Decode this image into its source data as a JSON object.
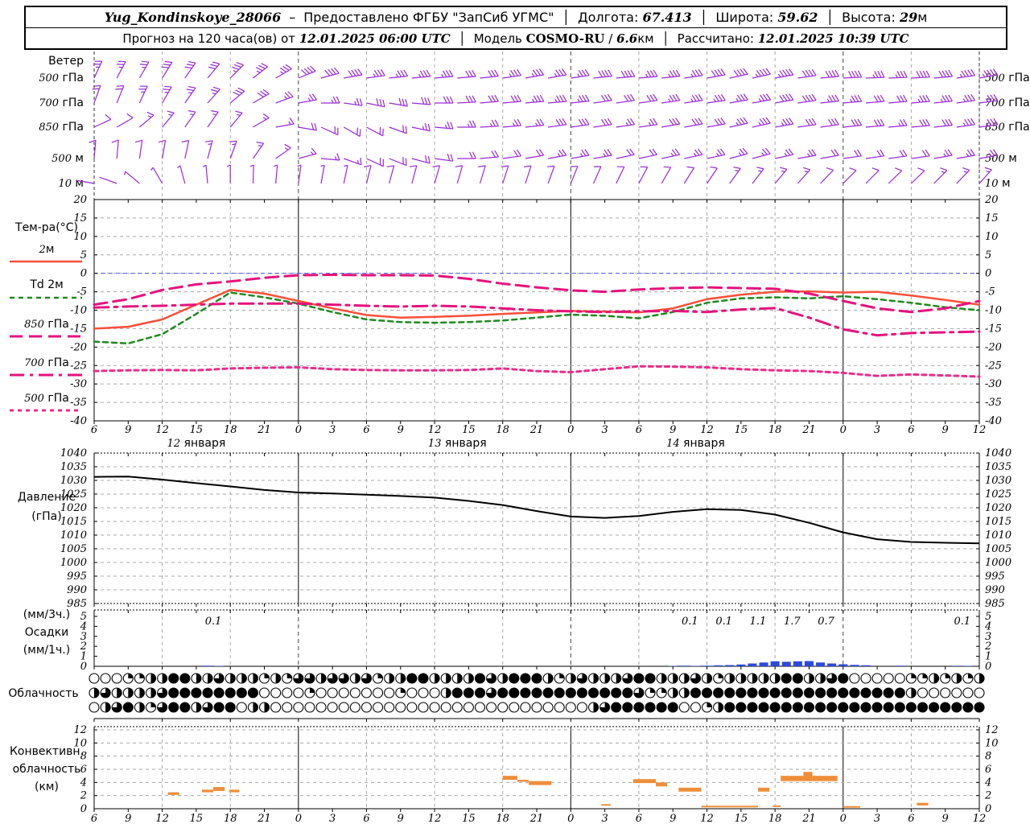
{
  "header": {
    "station": "Yug_Kondinskoye_28066",
    "dash": "–",
    "provided": "Предоставлено ФГБУ \"ЗапСиб УГМС\"",
    "lon_label": "Долгота:",
    "lon": "67.413",
    "lat_label": "Широта:",
    "lat": "59.62",
    "alt_label": "Высота:",
    "alt": "29",
    "alt_unit": "м",
    "sep": "│",
    "forecast_label": "Прогноз на 120 часа(ов) от",
    "forecast_start": "12.01.2025 06:00 UTC",
    "model_label": "Модель",
    "model": "COSMO-RU",
    "model_res_slash": "/",
    "model_res": "6.6",
    "model_res_unit": "км",
    "calc_label": "Рассчитано:",
    "calc_time": "12.01.2025 10:39 UTC"
  },
  "colors": {
    "wind": "#9a28d8",
    "temp_2m": "#f94f38",
    "td_2m": "#1f8a1f",
    "t850": "#e6127d",
    "t700": "#e6127d",
    "t500": "#ee2a8a",
    "pressure": "#000000",
    "precip": "#2b49dd",
    "convective": "#ef8e38",
    "zero_line": "#4a58f0",
    "grid": "#a8a8a8"
  },
  "time_axis": {
    "t_start_h": 0,
    "t_end_h": 78,
    "tick_step_h": 3,
    "labels": [
      "6",
      "9",
      "12",
      "15",
      "18",
      "21",
      "0",
      "3",
      "6",
      "9",
      "12",
      "15",
      "18",
      "21",
      "0",
      "3",
      "6",
      "9",
      "12",
      "15",
      "18",
      "21",
      "0",
      "3",
      "6",
      "9",
      "12"
    ],
    "midnights_t": [
      18,
      42,
      66
    ],
    "dates": [
      {
        "label": "12 января",
        "t": 9
      },
      {
        "label": "13 января",
        "t": 32
      },
      {
        "label": "14 января",
        "t": 53
      }
    ]
  },
  "wind_panel": {
    "title": "Ветер",
    "levels": [
      {
        "label": "500 гПа",
        "angles": [
          65,
          62,
          60,
          58,
          55,
          50,
          45,
          38,
          30,
          22,
          15,
          10,
          8,
          6,
          5,
          5,
          5,
          6,
          8,
          10,
          10,
          8,
          6,
          5,
          5,
          6,
          8,
          10,
          12,
          12,
          10,
          8,
          5,
          3,
          2,
          2,
          3,
          5,
          8,
          10
        ],
        "knots": [
          25,
          25,
          25,
          30,
          30,
          30,
          35,
          35,
          35,
          40,
          40,
          40,
          35,
          35,
          35,
          35,
          30,
          30,
          35,
          35,
          35,
          35,
          40,
          40,
          35,
          35,
          35,
          40,
          40,
          45,
          45,
          40,
          40,
          40,
          35,
          35,
          40,
          40,
          45,
          45
        ]
      },
      {
        "label": "700 гПа",
        "angles": [
          70,
          68,
          65,
          60,
          55,
          48,
          40,
          30,
          20,
          10,
          0,
          -8,
          -12,
          -10,
          -5,
          0,
          3,
          5,
          5,
          5,
          5,
          6,
          8,
          8,
          8,
          8,
          8,
          8,
          10,
          10,
          10,
          8,
          6,
          5,
          5,
          5,
          5,
          6,
          8,
          8
        ],
        "knots": [
          20,
          20,
          25,
          25,
          25,
          25,
          30,
          30,
          25,
          25,
          25,
          25,
          30,
          30,
          30,
          30,
          30,
          30,
          30,
          35,
          35,
          35,
          30,
          30,
          30,
          35,
          35,
          35,
          35,
          35,
          40,
          40,
          35,
          35,
          30,
          30,
          35,
          35,
          35,
          35
        ]
      },
      {
        "label": "850 гПа",
        "angles": [
          25,
          30,
          40,
          50,
          55,
          55,
          50,
          30,
          10,
          -10,
          -25,
          -30,
          -28,
          -20,
          -12,
          -5,
          0,
          3,
          5,
          6,
          8,
          8,
          8,
          8,
          8,
          10,
          10,
          10,
          12,
          12,
          10,
          8,
          8,
          6,
          5,
          5,
          5,
          6,
          8,
          8
        ],
        "knots": [
          10,
          10,
          15,
          15,
          15,
          15,
          15,
          15,
          15,
          20,
          20,
          20,
          20,
          20,
          25,
          25,
          25,
          25,
          25,
          25,
          30,
          30,
          30,
          25,
          25,
          30,
          30,
          30,
          35,
          35,
          35,
          30,
          30,
          30,
          30,
          25,
          30,
          30,
          35,
          35
        ]
      },
      {
        "label": "500 м",
        "angles": [
          85,
          85,
          82,
          80,
          78,
          75,
          70,
          55,
          35,
          15,
          -5,
          -20,
          -25,
          -22,
          -15,
          -8,
          0,
          5,
          8,
          10,
          10,
          10,
          10,
          12,
          12,
          12,
          12,
          12,
          15,
          15,
          12,
          10,
          10,
          8,
          8,
          8,
          8,
          10,
          10,
          10
        ],
        "knots": [
          10,
          10,
          10,
          10,
          10,
          15,
          15,
          15,
          15,
          15,
          15,
          15,
          20,
          20,
          20,
          20,
          20,
          20,
          20,
          20,
          25,
          25,
          25,
          20,
          20,
          25,
          25,
          25,
          25,
          25,
          25,
          25,
          20,
          20,
          20,
          20,
          20,
          25,
          25,
          25
        ]
      },
      {
        "label": "10 м",
        "angles": [
          170,
          160,
          140,
          120,
          105,
          95,
          90,
          88,
          85,
          82,
          80,
          78,
          76,
          75,
          75,
          74,
          74,
          73,
          72,
          72,
          70,
          68,
          66,
          64,
          62,
          60,
          58,
          56,
          54,
          52,
          50,
          48,
          46,
          45,
          45,
          44,
          44,
          45,
          46,
          48
        ],
        "knots": [
          3,
          3,
          5,
          5,
          5,
          5,
          8,
          8,
          8,
          8,
          8,
          8,
          10,
          10,
          10,
          10,
          10,
          10,
          10,
          10,
          12,
          12,
          10,
          10,
          10,
          12,
          12,
          12,
          15,
          15,
          15,
          15,
          12,
          12,
          12,
          12,
          12,
          15,
          15,
          15
        ]
      }
    ],
    "barb_step_h": 2
  },
  "chart_data": [
    {
      "type": "line",
      "id": "temperature",
      "title": "Тем-ра(°C)",
      "ylim": [
        -40,
        20
      ],
      "yticks": [
        "20",
        "15",
        "10",
        "5",
        "0",
        "-5",
        "-10",
        "-15",
        "-20",
        "-25",
        "-30",
        "-35",
        "-40"
      ],
      "t_step_h": 3,
      "series": [
        {
          "name": "2м",
          "style": "solid",
          "color_key": "temp_2m",
          "values": [
            -15,
            -14.5,
            -12.5,
            -8.5,
            -4.5,
            -5.5,
            -7.5,
            -9.5,
            -11.3,
            -12,
            -11.8,
            -11.5,
            -11,
            -10.6,
            -10.2,
            -10.4,
            -10.6,
            -9.5,
            -7,
            -5.8,
            -5,
            -4.9,
            -5.2,
            -5,
            -6,
            -7.2,
            -8.5
          ]
        },
        {
          "name": "Td 2м",
          "style": "dashed",
          "color_key": "td_2m",
          "values": [
            -18.5,
            -19,
            -16.5,
            -11,
            -5.2,
            -6.5,
            -8.2,
            -10.5,
            -12.5,
            -13.2,
            -13.4,
            -13.2,
            -12.8,
            -12,
            -11.2,
            -11.5,
            -12.2,
            -10.5,
            -8,
            -6.8,
            -6.5,
            -6.8,
            -6.2,
            -7,
            -8,
            -9.2,
            -10
          ]
        },
        {
          "name": "850 гПа",
          "style": "longdash",
          "color_key": "t850",
          "values": [
            -8.5,
            -7,
            -4.5,
            -3,
            -2.2,
            -1.2,
            -0.5,
            -0.4,
            -0.5,
            -0.5,
            -0.6,
            -1.5,
            -2.8,
            -3.8,
            -4.6,
            -5,
            -4.4,
            -4,
            -3.8,
            -4,
            -4.2,
            -5.5,
            -7.5,
            -9.5,
            -10.5,
            -9.5,
            -7.5
          ]
        },
        {
          "name": "700 гПа",
          "style": "dashdot",
          "color_key": "t700",
          "values": [
            -9.3,
            -9,
            -8.8,
            -8.5,
            -8.2,
            -8.2,
            -8.2,
            -8.5,
            -8.8,
            -9,
            -8.8,
            -9,
            -9.5,
            -10,
            -10.3,
            -10.5,
            -10.3,
            -10.2,
            -10.5,
            -9.8,
            -9.4,
            -12,
            -15.2,
            -16.8,
            -16.2,
            -16,
            -15.8
          ]
        },
        {
          "name": "500 гПа",
          "style": "dotted",
          "color_key": "t500",
          "values": [
            -26.5,
            -26.3,
            -26.2,
            -26.3,
            -25.8,
            -25.6,
            -25.5,
            -26,
            -26.2,
            -26.3,
            -26.3,
            -26.2,
            -25.8,
            -26.5,
            -26.8,
            -26,
            -25.2,
            -25.3,
            -25.5,
            -26,
            -26.3,
            -26.5,
            -27,
            -27.8,
            -27.4,
            -27.7,
            -28
          ]
        }
      ],
      "zero_line": 0
    },
    {
      "type": "line",
      "id": "pressure",
      "title": "Давление",
      "unit": "(гПа)",
      "ylim": [
        985,
        1040
      ],
      "yticks": [
        "1040",
        "1035",
        "1030",
        "1025",
        "1020",
        "1015",
        "1010",
        "1005",
        "1000",
        "995",
        "990",
        "985"
      ],
      "t_step_h": 3,
      "values": [
        1031.3,
        1031.4,
        1030.3,
        1029.0,
        1027.8,
        1026.5,
        1025.6,
        1025.2,
        1024.8,
        1024.3,
        1023.7,
        1022.5,
        1021.0,
        1018.8,
        1016.8,
        1016.3,
        1017.0,
        1018.5,
        1019.5,
        1019.2,
        1017.5,
        1014.5,
        1011.0,
        1008.5,
        1007.5,
        1007.2,
        1007.0
      ]
    },
    {
      "type": "bar",
      "id": "precipitation",
      "title_lines": [
        "(мм/3ч.)",
        "Осадки",
        "(мм/1ч.)"
      ],
      "ylim": [
        0,
        5
      ],
      "yticks": [
        "5",
        "4",
        "3",
        "2",
        "1",
        "0"
      ],
      "labels_3h": [
        {
          "t": 10.5,
          "value": "0.1"
        },
        {
          "t": 52.5,
          "value": "0.1"
        },
        {
          "t": 55.5,
          "value": "0.1"
        },
        {
          "t": 58.5,
          "value": "1.1"
        },
        {
          "t": 61.5,
          "value": "1.7"
        },
        {
          "t": 64.5,
          "value": "0.7"
        },
        {
          "t": 76.5,
          "value": "0.1"
        }
      ],
      "hourly_bars": [
        {
          "t": 10,
          "h": 0.06
        },
        {
          "t": 11,
          "h": 0.04
        },
        {
          "t": 51,
          "h": 0.04
        },
        {
          "t": 52,
          "h": 0.06
        },
        {
          "t": 53,
          "h": 0.04
        },
        {
          "t": 54,
          "h": 0.06
        },
        {
          "t": 55,
          "h": 0.1
        },
        {
          "t": 56,
          "h": 0.12
        },
        {
          "t": 57,
          "h": 0.18
        },
        {
          "t": 58,
          "h": 0.28
        },
        {
          "t": 59,
          "h": 0.38
        },
        {
          "t": 60,
          "h": 0.5
        },
        {
          "t": 61,
          "h": 0.45
        },
        {
          "t": 62,
          "h": 0.5
        },
        {
          "t": 63,
          "h": 0.52
        },
        {
          "t": 64,
          "h": 0.38
        },
        {
          "t": 65,
          "h": 0.28
        },
        {
          "t": 66,
          "h": 0.2
        },
        {
          "t": 67,
          "h": 0.14
        },
        {
          "t": 68,
          "h": 0.1
        },
        {
          "t": 71,
          "h": 0.06
        },
        {
          "t": 76,
          "h": 0.05
        },
        {
          "t": 77,
          "h": 0.04
        }
      ]
    },
    {
      "type": "heatmap",
      "id": "cloudiness",
      "title": "Облачность",
      "note": "three rows of hourly cloud-cover circles, fill in eighths 0-8",
      "rows": [
        "0002244884464442426646646244884444864888424644468844464244444884468000002242424",
        "4644446888888880000200000002000488868888888888886224488888888888888888884000000",
        "0468426884688044000000000000000000000000000046888888002488888888888888888888888"
      ]
    },
    {
      "type": "bar",
      "id": "convective_cloud",
      "title_lines": [
        "Конвективн.",
        "облачность",
        "(км)"
      ],
      "ylim": [
        0,
        12
      ],
      "yticks": [
        "12",
        "10",
        "8",
        "6",
        "4",
        "2",
        "0"
      ],
      "segments": [
        {
          "t0": 6.5,
          "t1": 7.5,
          "base": 2.1,
          "top": 2.5
        },
        {
          "t0": 9.5,
          "t1": 10.5,
          "base": 2.5,
          "top": 2.9
        },
        {
          "t0": 10.5,
          "t1": 11.5,
          "base": 2.7,
          "top": 3.3
        },
        {
          "t0": 11.9,
          "t1": 12.8,
          "base": 2.5,
          "top": 2.9
        },
        {
          "t0": 36,
          "t1": 37.3,
          "base": 4.4,
          "top": 5.0
        },
        {
          "t0": 37.3,
          "t1": 38.3,
          "base": 4.1,
          "top": 4.4
        },
        {
          "t0": 38.3,
          "t1": 40.3,
          "base": 3.6,
          "top": 4.2
        },
        {
          "t0": 44.7,
          "t1": 45.5,
          "base": 0.5,
          "top": 0.7
        },
        {
          "t0": 47.5,
          "t1": 49.5,
          "base": 3.9,
          "top": 4.5
        },
        {
          "t0": 49.5,
          "t1": 50.5,
          "base": 3.4,
          "top": 4.0
        },
        {
          "t0": 51.5,
          "t1": 53.5,
          "base": 2.6,
          "top": 3.2
        },
        {
          "t0": 53.5,
          "t1": 58.5,
          "base": 0.25,
          "top": 0.45
        },
        {
          "t0": 58.5,
          "t1": 59.5,
          "base": 2.6,
          "top": 3.2
        },
        {
          "t0": 59.8,
          "t1": 60.5,
          "base": 0.3,
          "top": 0.5
        },
        {
          "t0": 60.5,
          "t1": 62.5,
          "base": 4.2,
          "top": 5.0
        },
        {
          "t0": 62.5,
          "t1": 63.3,
          "base": 4.2,
          "top": 5.6
        },
        {
          "t0": 63.3,
          "t1": 65.5,
          "base": 4.2,
          "top": 5.0
        },
        {
          "t0": 66,
          "t1": 67.5,
          "base": 0.2,
          "top": 0.4
        },
        {
          "t0": 72.5,
          "t1": 73.5,
          "base": 0.5,
          "top": 0.9
        }
      ]
    }
  ]
}
